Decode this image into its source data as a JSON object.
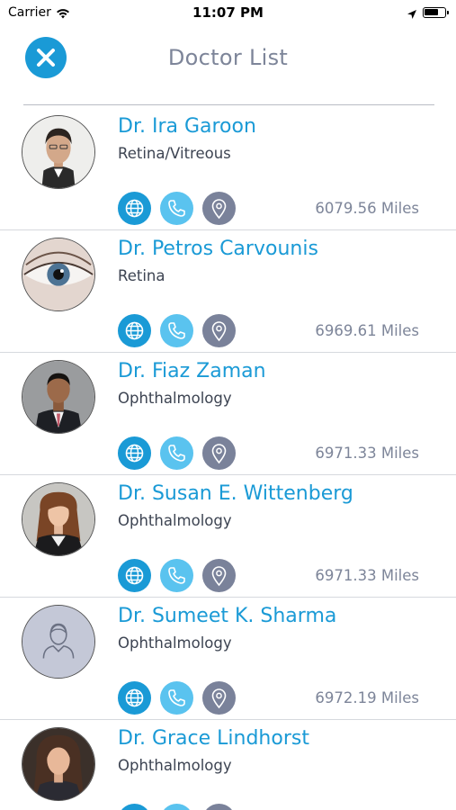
{
  "status_bar": {
    "carrier": "Carrier",
    "time": "11:07 PM"
  },
  "header": {
    "title": "Doctor List",
    "close_icon": "close-icon",
    "accent_color": "#1a9ad6"
  },
  "doctors": [
    {
      "name": "Dr. Ira Garoon",
      "specialty": "Retina/Vitreous",
      "distance": "6079.56 Miles",
      "photo": "portrait-man-suit-glasses"
    },
    {
      "name": "Dr. Petros Carvounis",
      "specialty": "Retina",
      "distance": "6969.61 Miles",
      "photo": "eye-closeup"
    },
    {
      "name": "Dr. Fiaz Zaman",
      "specialty": "Ophthalmology",
      "distance": "6971.33 Miles",
      "photo": "portrait-man-suit"
    },
    {
      "name": "Dr. Susan E. Wittenberg",
      "specialty": "Ophthalmology",
      "distance": "6971.33 Miles",
      "photo": "portrait-woman"
    },
    {
      "name": "Dr. Sumeet K. Sharma",
      "specialty": "Ophthalmology",
      "distance": "6972.19 Miles",
      "photo": "placeholder-person-icon"
    },
    {
      "name": "Dr. Grace Lindhorst",
      "specialty": "Ophthalmology",
      "distance": "",
      "photo": "portrait-woman-dark-hair"
    }
  ],
  "colors": {
    "name_blue": "#1a9ad6",
    "web_button": "#1a9ad6",
    "call_button": "#5ac3ef",
    "map_button": "#7a829a",
    "muted_text": "#7d8599"
  }
}
